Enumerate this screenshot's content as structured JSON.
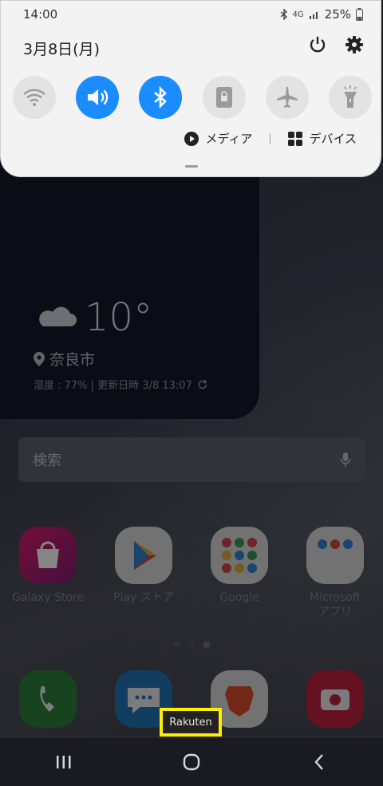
{
  "status_bar": {
    "time": "14:00",
    "network": "4G",
    "battery": "25%"
  },
  "quick_panel": {
    "date": "3月8日(月)",
    "tiles": [
      {
        "name": "wifi",
        "on": false
      },
      {
        "name": "sound",
        "on": true
      },
      {
        "name": "bluetooth",
        "on": true
      },
      {
        "name": "lock",
        "on": false
      },
      {
        "name": "airplane",
        "on": false
      },
      {
        "name": "flashlight",
        "on": false
      }
    ],
    "media_label": "メディア",
    "devices_label": "デバイス"
  },
  "weather": {
    "temperature": "10°",
    "location": "奈良市",
    "meta": "湿度 : 77% | 更新日時 3/8 13:07"
  },
  "search": {
    "placeholder": "検索"
  },
  "apps": [
    {
      "label": "Galaxy Store"
    },
    {
      "label": "Play ストア"
    },
    {
      "label": "Google"
    },
    {
      "label": "Microsoft\nアプリ"
    }
  ],
  "dock_tooltip": "Rakuten",
  "colors": {
    "accent": "#1a8cff",
    "highlight": "#ffee00"
  }
}
